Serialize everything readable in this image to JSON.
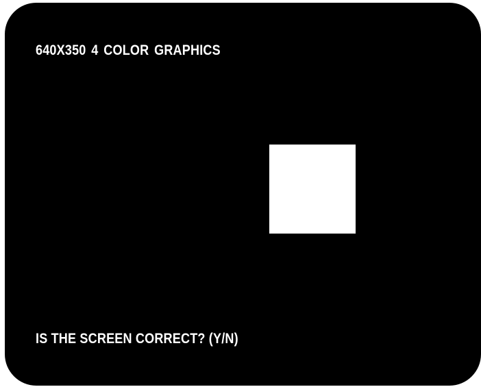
{
  "screen": {
    "mode_label": "640X350  4 COLOR GRAPHICS",
    "prompt": "IS THE SCREEN CORRECT? (Y/N)",
    "test_box_color": "#ffffff",
    "background_color": "#000000"
  }
}
